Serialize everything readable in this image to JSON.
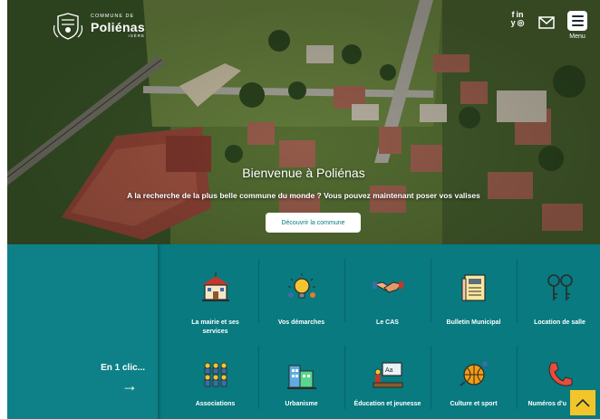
{
  "header": {
    "logo_commune": "COMMUNE DE",
    "logo_name": "Poliénas",
    "logo_dept": "ISÈRE",
    "menu_label": "Menu",
    "social_fb": "f",
    "social_in": "in",
    "social_tw": "y",
    "social_ig": "◎"
  },
  "hero": {
    "title": "Bienvenue à Poliénas",
    "subtitle": "A la recherche de la plus belle commune du monde ? Vous pouvez maintenant poser vos valises",
    "button": "Découvrir la commune"
  },
  "quick": {
    "label": "En 1 clic...",
    "arrow": "→",
    "row1": [
      {
        "label": "La mairie et ses services",
        "icon": "town-hall-icon"
      },
      {
        "label": "Vos démarches",
        "icon": "lightbulb-icon"
      },
      {
        "label": "Le CAS",
        "icon": "handshake-icon"
      },
      {
        "label": "Bulletin Municipal",
        "icon": "newspaper-icon"
      },
      {
        "label": "Location de salle",
        "icon": "keys-icon"
      }
    ],
    "row2": [
      {
        "label": "Associations",
        "icon": "people-group-icon"
      },
      {
        "label": "Urbanisme",
        "icon": "buildings-icon"
      },
      {
        "label": "Éducation et jeunesse",
        "icon": "classroom-icon"
      },
      {
        "label": "Culture et sport",
        "icon": "sports-ball-icon"
      },
      {
        "label": "Numéros d'u",
        "icon": "phone-icon"
      }
    ]
  },
  "colors": {
    "teal": "#087a80",
    "accent": "#f2c52b"
  }
}
